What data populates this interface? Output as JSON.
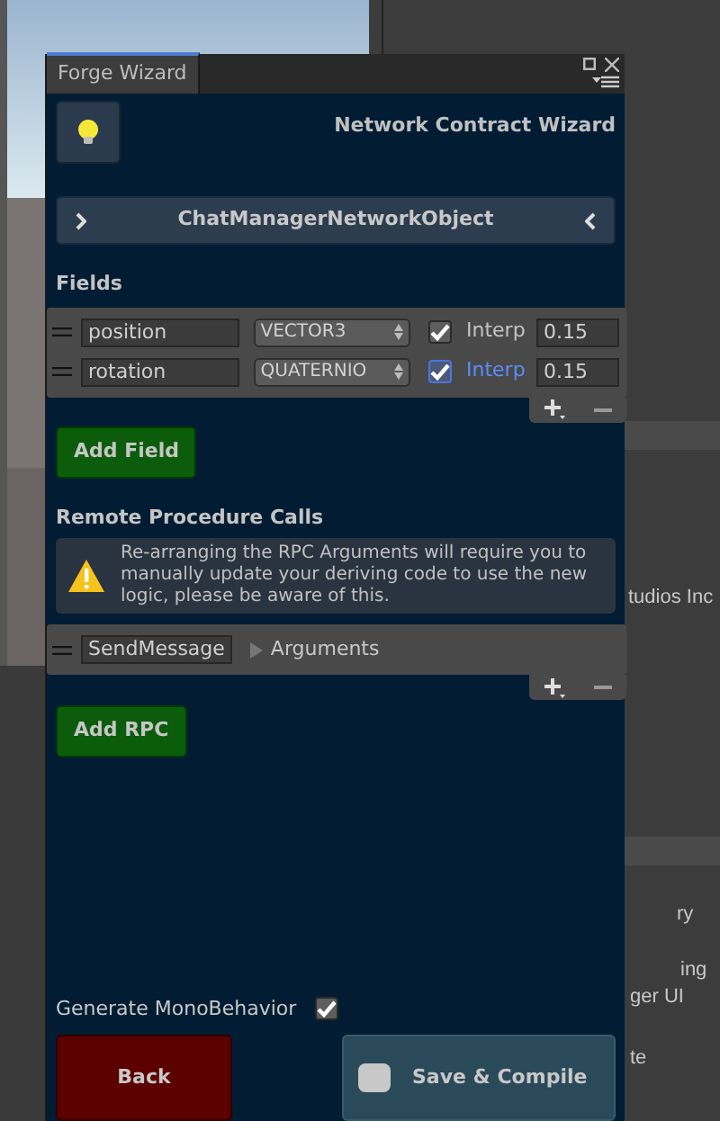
{
  "background": {
    "texts": [
      "tudios Inc",
      "ry",
      "ing",
      "ger UI",
      "te"
    ]
  },
  "window": {
    "tab": "Forge Wizard",
    "heading": "Network Contract Wizard",
    "object_name": "ChatManagerNetworkObject"
  },
  "fields": {
    "title": "Fields",
    "rows": [
      {
        "name": "position",
        "type": "VECTOR3",
        "interpolate": true,
        "focused": false,
        "label": "Interp",
        "value": "0.15"
      },
      {
        "name": "rotation",
        "type": "QUATERNIO",
        "interpolate": true,
        "focused": true,
        "label": "Interp",
        "value": "0.15"
      }
    ],
    "add_button": "Add Field"
  },
  "rpcs": {
    "title": "Remote Procedure Calls",
    "warning": "Re-arranging the RPC Arguments will require you to manually update your deriving code to use the new logic, please be aware of this.",
    "rows": [
      {
        "name": "SendMessage",
        "arguments": "Arguments",
        "expanded": false
      }
    ],
    "add_button": "Add RPC"
  },
  "generate_monobehavior": {
    "label": "Generate MonoBehavior",
    "checked": true
  },
  "buttons": {
    "back": "Back",
    "save": "Save & Compile"
  }
}
